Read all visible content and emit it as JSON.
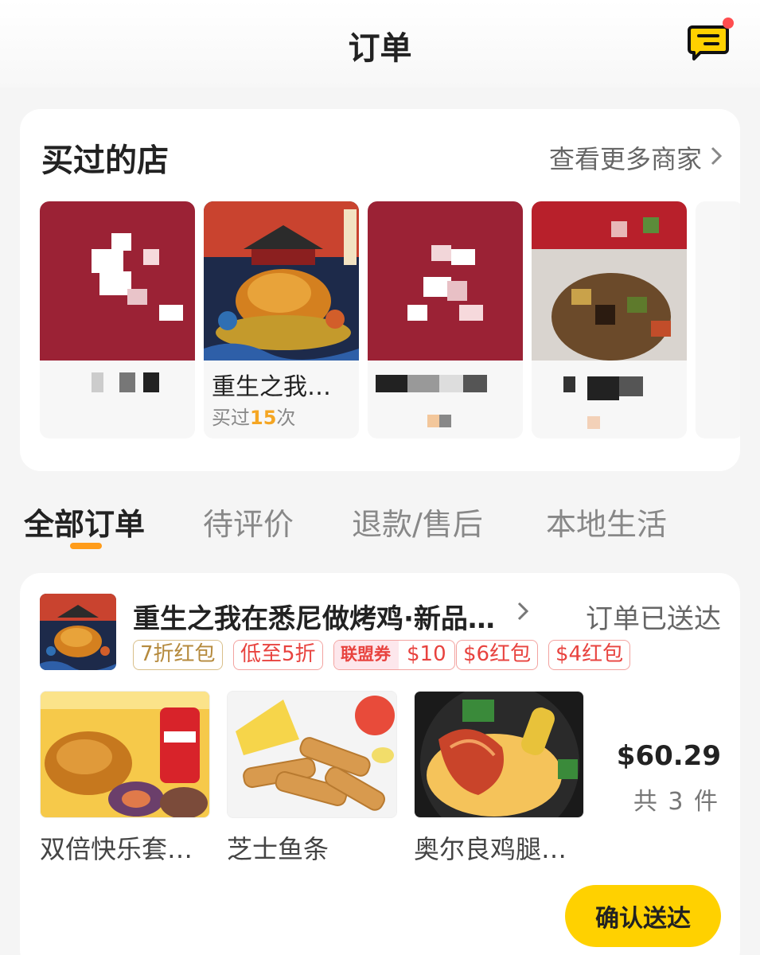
{
  "header": {
    "title": "订单",
    "message_icon": "chat-message-icon"
  },
  "shops": {
    "title": "买过的店",
    "more_label": "查看更多商家",
    "items": [
      {
        "name": "",
        "sub": ""
      },
      {
        "name": "重生之我…",
        "sub_prefix": "买过",
        "sub_count": "15",
        "sub_suffix": "次"
      },
      {
        "name": "",
        "sub": ""
      },
      {
        "name": "",
        "sub": ""
      }
    ]
  },
  "tabs": [
    {
      "label": "全部订单",
      "active": true
    },
    {
      "label": "待评价"
    },
    {
      "label": "退款/售后"
    },
    {
      "label": "本地生活"
    }
  ],
  "order": {
    "shop_name": "重生之我在悉尼做烤鸡·新品…",
    "status": "订单已送达",
    "tags": {
      "t1": "7折红包",
      "t2": "低至5折",
      "union_label": "联盟券",
      "union_value": "$10",
      "t4": "$6红包",
      "t5": "$4红包"
    },
    "items": [
      {
        "name": "双倍快乐套…"
      },
      {
        "name": "芝士鱼条"
      },
      {
        "name": "奥尔良鸡腿…"
      }
    ],
    "price": "$60.29",
    "count": "共 3 件",
    "confirm_label": "确认送达"
  },
  "colors": {
    "accent": "#ffd100",
    "tab_underline": "#ff9c1a",
    "tag_red": "#e8433f",
    "tag_gold": "#b58a3d"
  }
}
